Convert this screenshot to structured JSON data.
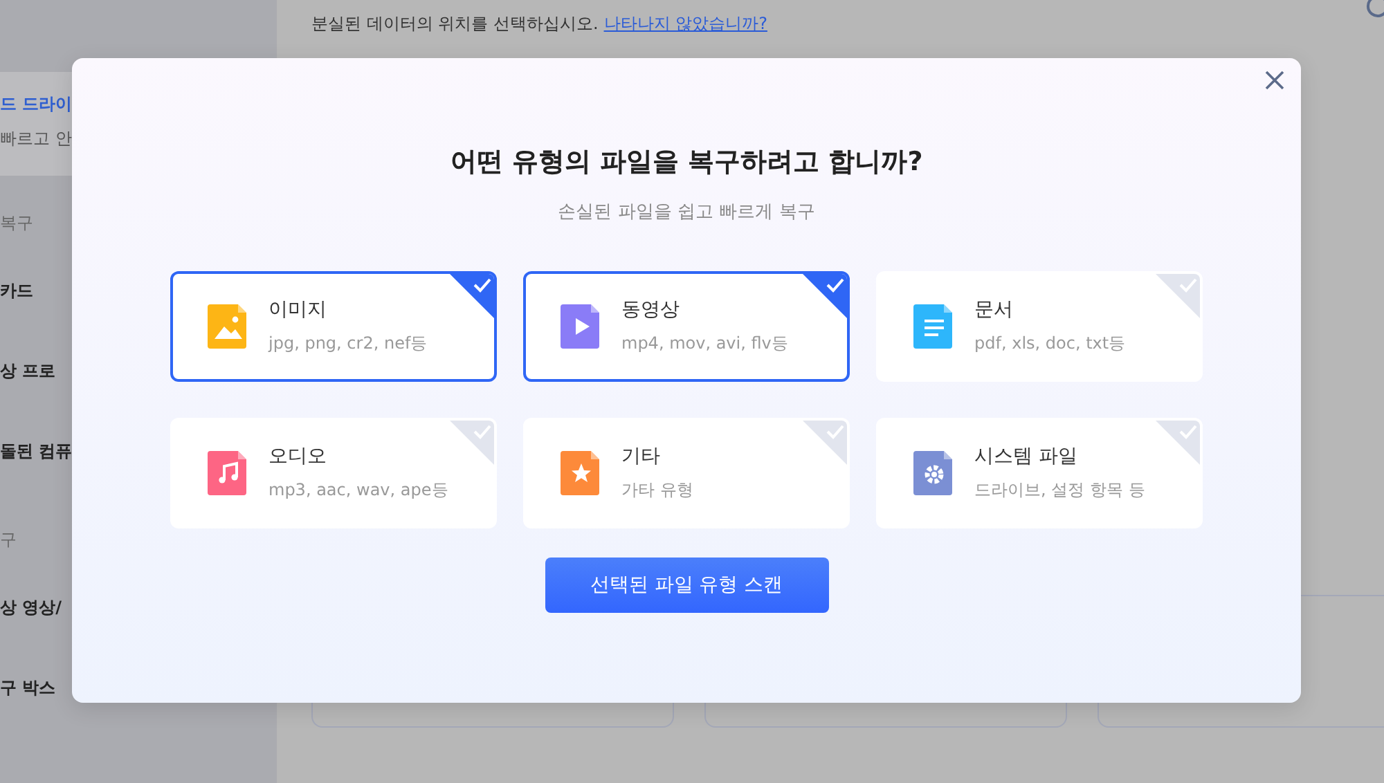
{
  "sidebar": {
    "items": [
      {
        "kind": "item",
        "title": "드 드라이",
        "subtitle": "빠르고 안",
        "selected": true
      },
      {
        "kind": "section",
        "title": "복구"
      },
      {
        "kind": "item",
        "title": "카드",
        "selected": false
      },
      {
        "kind": "item",
        "title": "상 프로",
        "selected": false
      },
      {
        "kind": "item",
        "title": "돌된 컴퓨",
        "selected": false
      },
      {
        "kind": "section",
        "title": "구"
      },
      {
        "kind": "item",
        "title": "상 영상/",
        "selected": false
      },
      {
        "kind": "item",
        "title": "구 박스",
        "selected": false
      }
    ]
  },
  "main": {
    "instruction": "분실된 데이터의 위치를 선택하십시오.",
    "help_link": "나타나지 않았습니까?"
  },
  "dialog": {
    "title": "어떤 유형의 파일을 복구하려고 합니까?",
    "subtitle": "손실된 파일을 쉽고 빠르게 복구",
    "file_types": [
      {
        "kind": "image",
        "name": "이미지",
        "extensions": "jpg, png, cr2, nef등",
        "selected": true
      },
      {
        "kind": "video",
        "name": "동영상",
        "extensions": "mp4, mov, avi, flv등",
        "selected": true
      },
      {
        "kind": "document",
        "name": "문서",
        "extensions": "pdf, xls, doc, txt등",
        "selected": false
      },
      {
        "kind": "audio",
        "name": "오디오",
        "extensions": "mp3, aac, wav, ape등",
        "selected": false
      },
      {
        "kind": "other",
        "name": "기타",
        "extensions": "가타 유형",
        "selected": false
      },
      {
        "kind": "system",
        "name": "시스템 파일",
        "extensions": "드라이브, 설정 항목 등",
        "selected": false
      }
    ],
    "scan_button": "선택된 파일 유형 스캔"
  }
}
